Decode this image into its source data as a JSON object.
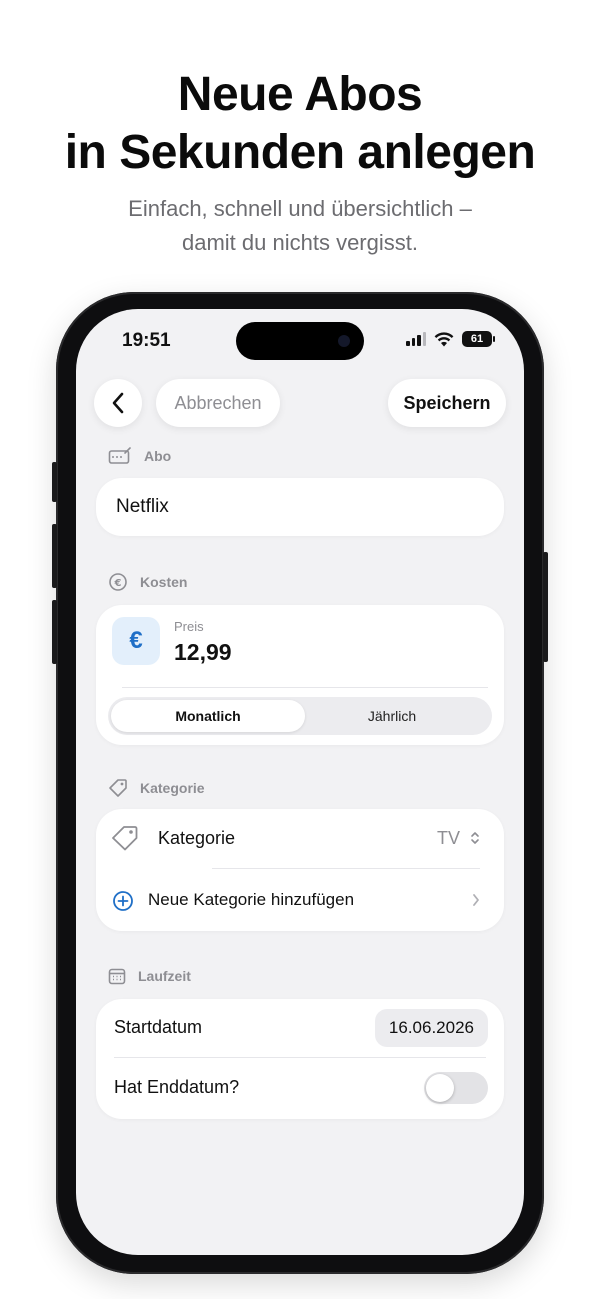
{
  "hero": {
    "title_line1": "Neue Abos",
    "title_line2": "in Sekunden anlegen",
    "subtitle_line1": "Einfach, schnell und übersichtlich –",
    "subtitle_line2": "damit du nichts vergisst."
  },
  "status_bar": {
    "time": "19:51",
    "battery": "61",
    "icons": [
      "signal-icon",
      "wifi-icon",
      "battery-icon"
    ]
  },
  "nav": {
    "back_icon": "chevron-left-icon",
    "cancel_label": "Abbrechen",
    "save_label": "Speichern"
  },
  "sections": {
    "abo": {
      "label": "Abo",
      "icon": "card-icon",
      "value": "Netflix"
    },
    "kosten": {
      "label": "Kosten",
      "icon": "euro-circle-icon",
      "price_label": "Preis",
      "price_value": "12,99",
      "currency_symbol": "€",
      "billing_options": [
        "Monatlich",
        "Jährlich"
      ],
      "billing_selected": "Monatlich"
    },
    "kategorie": {
      "label": "Kategorie",
      "icon": "tag-icon",
      "field_label": "Kategorie",
      "field_value": "TV",
      "add_label": "Neue Kategorie hinzufügen"
    },
    "laufzeit": {
      "label": "Laufzeit",
      "icon": "calendar-icon",
      "start_label": "Startdatum",
      "start_value": "16.06.2026",
      "end_label": "Hat Enddatum?",
      "end_toggle_on": false
    }
  },
  "colors": {
    "accent_blue": "#1f6fc7",
    "background": "#f2f2f4",
    "card": "#ffffff",
    "muted_text": "#8e8e93"
  }
}
